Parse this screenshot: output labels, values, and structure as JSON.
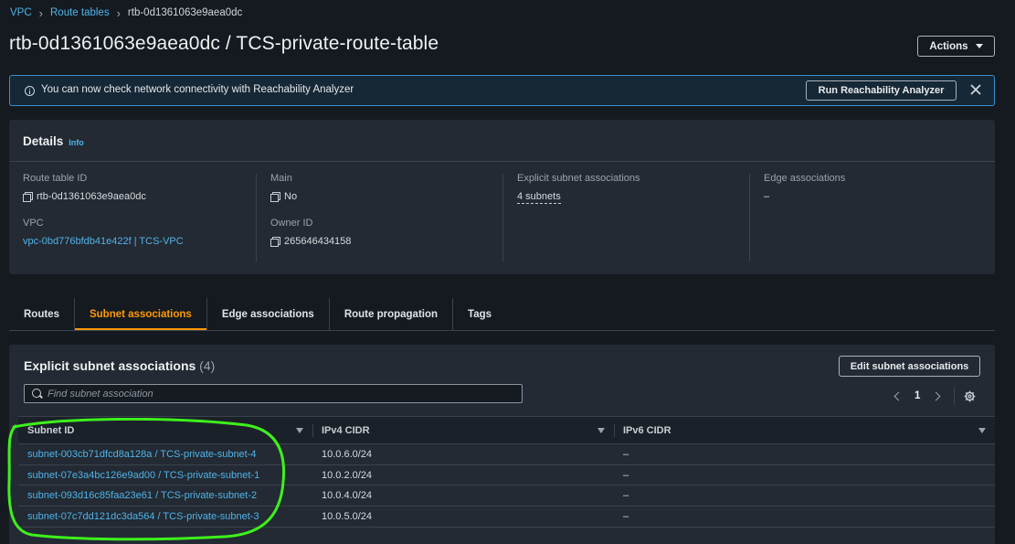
{
  "breadcrumb": {
    "vpc": "VPC",
    "route_tables": "Route tables",
    "current": "rtb-0d1361063e9aea0dc"
  },
  "page_title": "rtb-0d1361063e9aea0dc / TCS-private-route-table",
  "actions_label": "Actions",
  "banner": {
    "message": "You can now check network connectivity with Reachability Analyzer",
    "button": "Run Reachability Analyzer"
  },
  "details": {
    "title": "Details",
    "info": "Info",
    "route_table_id_label": "Route table ID",
    "route_table_id": "rtb-0d1361063e9aea0dc",
    "vpc_label": "VPC",
    "vpc": "vpc-0bd776bfdb41e422f | TCS-VPC",
    "main_label": "Main",
    "main": "No",
    "owner_id_label": "Owner ID",
    "owner_id": "265646434158",
    "explicit_label": "Explicit subnet associations",
    "explicit": "4 subnets",
    "edge_label": "Edge associations",
    "edge": "–"
  },
  "tabs": [
    {
      "label": "Routes"
    },
    {
      "label": "Subnet associations"
    },
    {
      "label": "Edge associations"
    },
    {
      "label": "Route propagation"
    },
    {
      "label": "Tags"
    }
  ],
  "panel": {
    "title": "Explicit subnet associations",
    "count": "(4)",
    "edit_button": "Edit subnet associations",
    "search_placeholder": "Find subnet association",
    "page": "1",
    "columns": [
      "Subnet ID",
      "IPv4 CIDR",
      "IPv6 CIDR"
    ],
    "rows": [
      {
        "subnet": "subnet-003cb71dfcd8a128a / TCS-private-subnet-4",
        "ipv4": "10.0.6.0/24",
        "ipv6": "–"
      },
      {
        "subnet": "subnet-07e3a4bc126e9ad00 / TCS-private-subnet-1",
        "ipv4": "10.0.2.0/24",
        "ipv6": "–"
      },
      {
        "subnet": "subnet-093d16c85faa23e61 / TCS-private-subnet-2",
        "ipv4": "10.0.4.0/24",
        "ipv6": "–"
      },
      {
        "subnet": "subnet-07c7dd121dc3da564 / TCS-private-subnet-3",
        "ipv4": "10.0.5.0/24",
        "ipv6": "–"
      }
    ]
  },
  "colors": {
    "accent": "#ff9900",
    "link": "#4fb3e8",
    "highlight": "#3ef01c"
  }
}
